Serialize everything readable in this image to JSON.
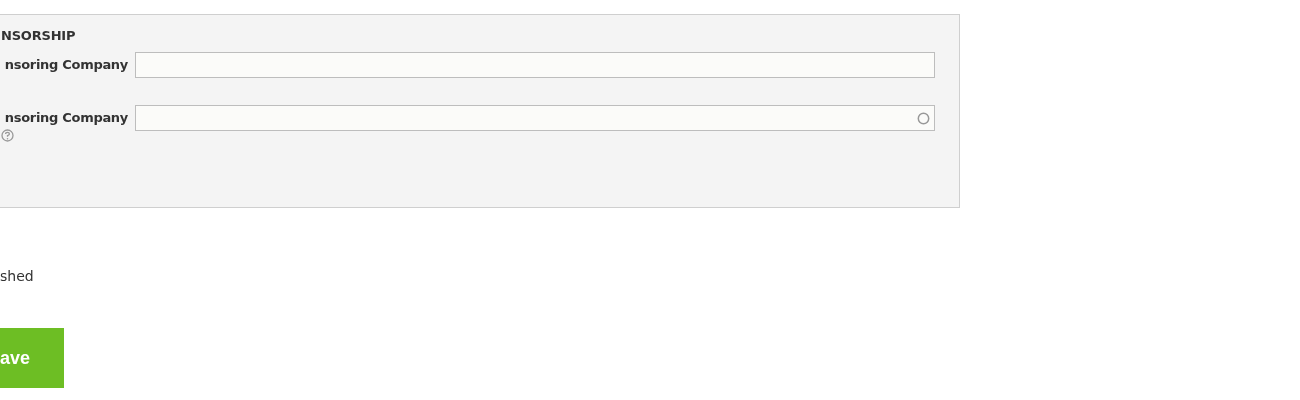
{
  "section": {
    "heading": "NSORSHIP",
    "fields": [
      {
        "kind": "text",
        "label": "nsoring Company",
        "help": false
      },
      {
        "kind": "lookup",
        "label": "nsoring Company",
        "help": true
      }
    ]
  },
  "status": "shed",
  "save_button": "ave"
}
